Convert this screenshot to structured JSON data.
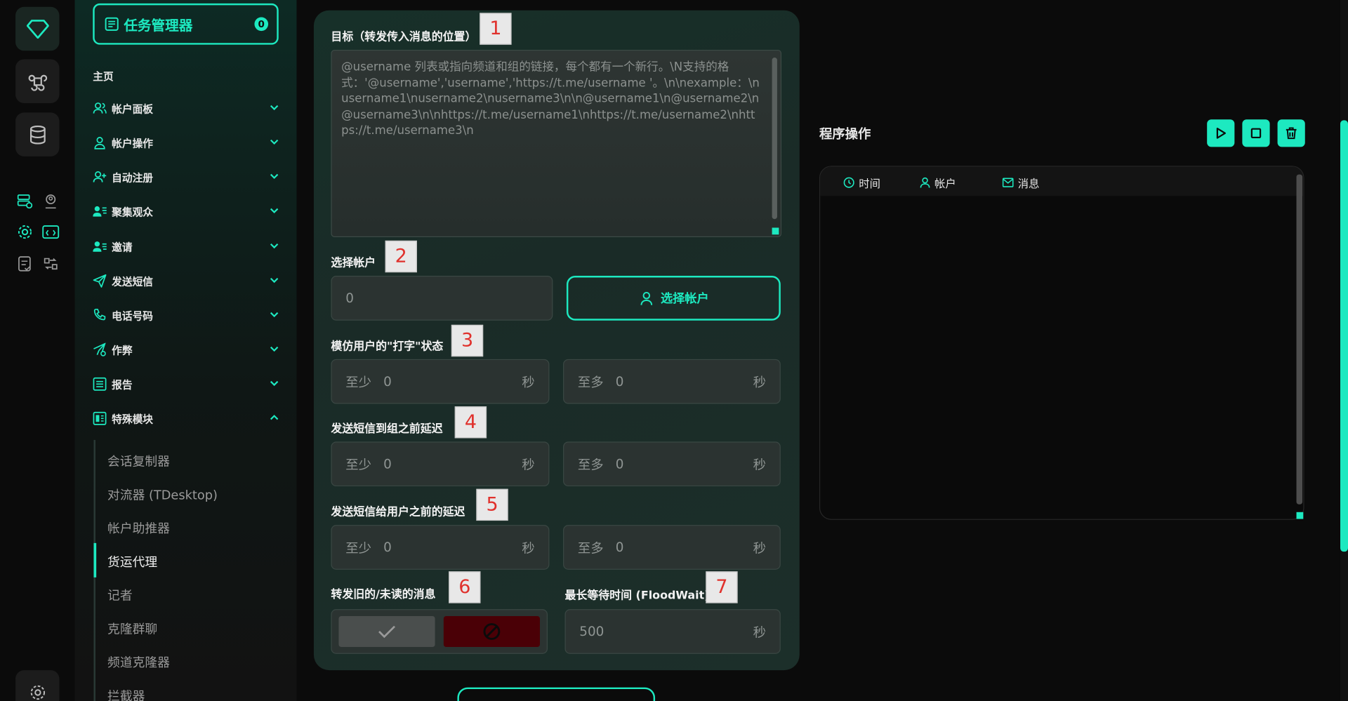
{
  "sidebar": {
    "task_manager": {
      "label": "任务管理器",
      "count": "0"
    },
    "home_label": "主页",
    "items": [
      {
        "label": "帐户面板",
        "icon": "users-icon"
      },
      {
        "label": "帐户操作",
        "icon": "user-icon"
      },
      {
        "label": "自动注册",
        "icon": "user-plus-icon"
      },
      {
        "label": "聚集观众",
        "icon": "users-list-icon"
      },
      {
        "label": "邀请",
        "icon": "user-invite-icon"
      },
      {
        "label": "发送短信",
        "icon": "send-icon"
      },
      {
        "label": "电话号码",
        "icon": "phone-icon"
      },
      {
        "label": "作弊",
        "icon": "send-gear-icon"
      },
      {
        "label": "报告",
        "icon": "report-icon"
      },
      {
        "label": "特殊模块",
        "icon": "modules-icon"
      }
    ],
    "sub_items": [
      "会话复制器",
      "对流器 (TDesktop)",
      "帐户助推器",
      "货运代理",
      "记者",
      "克隆群聊",
      "频道克隆器",
      "拦截器"
    ],
    "active_sub": "货运代理"
  },
  "form": {
    "target": {
      "label": "目标（转发传入消息的位置）",
      "badge": "1",
      "placeholder": "@username 列表或指向频道和组的链接，每个都有一个新行。\\N支持的格式：'@username','username','https://t.me/username '。\\n\\nexample：\\nusername1\\nusername2\\nusername3\\n\\n@username1\\n@username2\\n@username3\\n\\nhttps://t.me/username1\\nhttps://t.me/username2\\nhttps://t.me/username3\\n"
    },
    "accounts": {
      "label": "选择帐户",
      "badge": "2",
      "value": "0",
      "button": "选择帐户"
    },
    "typing": {
      "label": "模仿用户的\"打字\"状态",
      "badge": "3"
    },
    "group_delay": {
      "label": "发送短信到组之前延迟",
      "badge": "4"
    },
    "user_delay": {
      "label": "发送短信给用户之前的延迟",
      "badge": "5"
    },
    "range": {
      "min_prefix": "至少",
      "max_prefix": "至多",
      "unit": "秒",
      "min_value": "0",
      "max_value": "0"
    },
    "forward_old": {
      "label": "转发旧的/未读的消息",
      "badge": "6"
    },
    "flood_wait": {
      "label": "最长等待时间 (FloodWait)",
      "badge": "7",
      "value": "500",
      "unit": "秒"
    }
  },
  "operations": {
    "title": "程序操作",
    "columns": [
      "时间",
      "帐户",
      "消息"
    ]
  },
  "colors": {
    "accent": "#1de9c0",
    "deny": "#4a0006"
  }
}
